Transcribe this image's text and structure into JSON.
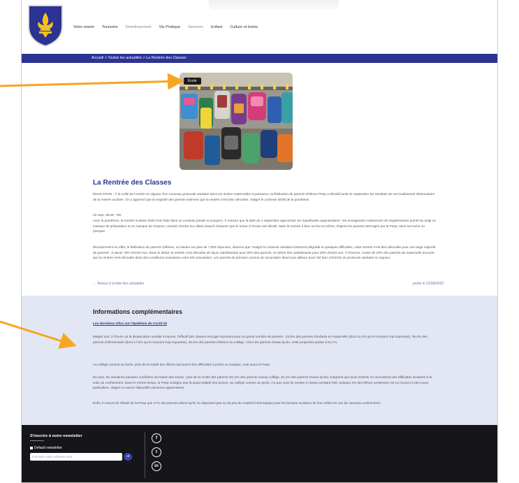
{
  "header": {
    "nav": [
      {
        "label": "Votre mairie",
        "muted": false
      },
      {
        "label": "Tourisme",
        "muted": false
      },
      {
        "label": "Divertissement",
        "muted": true
      },
      {
        "label": "Vie Pratique",
        "muted": false
      },
      {
        "label": "Sionnom",
        "muted": true
      },
      {
        "label": "Enfant",
        "muted": false
      },
      {
        "label": "Culture et loisirs",
        "muted": false
      }
    ]
  },
  "breadcrumb": "Accueil > Toutes les actualités > La Rentrée des Classes",
  "article": {
    "tag": "École",
    "title": "La Rentrée des Classes",
    "p1": "ÉDUCATION - À la veille de l'entrée en vigueur d'un nouveau protocole sanitaire dans les écoles maternelles et primaires, la fédération de parents d'élèves Peep a dévoilé lundi 21 septembre les résultats de son traditionnel Observatoire de la rentrée scolaire. On y apprend que la majorité des parents estiment que la rentrée s'est bien déroulée, malgré le contexte inédit de la pandémie.",
    "meta": "22 sept. 08:28 - RD",
    "p2": "Avec la pandémie, la rentrée scolaire 2020 s'est faite dans un contexte jamais vu jusqu'ici. À mesure que la date du 1 septembre approchait, les inquiétudes augmentaient : les enseignants notamment ont régulièrement pointé du doigt un manque de préparation et un manque de moyens, certains d'entre eux allant jusqu'à réclamer que le retour à l'école soit décalé. Mais la rentrée a bien eu lieu et même, d'après les parents interrogés par la Peep, sans accroche ou presque.",
    "p3": "Étonnamment en effet, la fédération de parents d'élèves, se basant sur plus de 7.000 réponses, observe que \"malgré le contexte sanitaire fortement dégradé et quelques difficultés, cette rentrée s'est bien déroulée pour une large majorité de parents\", à savoir 79% d'entre eux. Dans le détail, la rentrée s'est déroulée de façon satisfaisante pour 50% des parents, et même très satisfaisante pour 29% d'entre eux. À l'inverse, moins de 20% des parents de maternelle trouvent que la rentrée s'est déroulée dans des conditions mauvaises voire très mauvaises. Les parents du primaire comme du secondaire disent par ailleurs avoir été bien informés du protocole sanitaire en vigueur.",
    "back_link": "← Retour à la liste des actualités",
    "posted": "posté le 22/09/2020"
  },
  "info": {
    "heading": "Informations complémentaires",
    "link": "Les dernières infos sur l'épidémie de Covid-19",
    "p1": "Malgré tout, à l'heure où la distanciation sociale s'impose, l'effectif des classes est jugé important pour un grand nombre de parents : 43,6% des parents d'enfants en maternelle (dont 21,2% qui le trouvent trop important), 39,2% des parents d'élémentaire (dont 17,6% qui le trouvent trop important), 46,4% des parents d'élèves au collège. Chez les parents niveau lycée, cette proportion passe à 61,7%.",
    "p2": "Au collège comme au lycée, près de la moitié des élèves éprouvent des difficultés à porter un masque, note aussi la Peep.",
    "p3": "De plus, les semaines passées confinées ont laissé des traces : plus de la moitié des parents (51,2% des parents niveau collège, 54,1% des parents niveau lycée) craignent que leurs enfants ne rencontrent des difficultés scolaires à la suite du confinement. Dans le même temps, la Peep souligne que la quasi-totalité des jeunes, au collège comme au lycée, n'a pas suivi de remise à niveau pendant l'été, puisque 3% des élèves seulement ont eu recours à des cours particuliers, stages ou autres dispositifs vacances apprenantes.",
    "p4": "Enfin, il ressort de l'étude de la Peep que 17% des parents disent qu'ils ne disposent pas ou de peu de matériel informatique pour les besoins scolaires de leur enfant en cas de nouveau confinement."
  },
  "footer": {
    "newsletter_title": "S'inscrire à notre newsletter",
    "checkbox_label": "Default newsletter",
    "email_placeholder": "Inscrivez votre adresse mail",
    "submit_glyph": "➜",
    "social": [
      "f",
      "t",
      "in"
    ]
  },
  "colors": {
    "brand_blue": "#2b3393",
    "info_bg": "#e3e6f3",
    "footer_bg": "#16161a",
    "annotation_arrow": "#f5a623"
  }
}
